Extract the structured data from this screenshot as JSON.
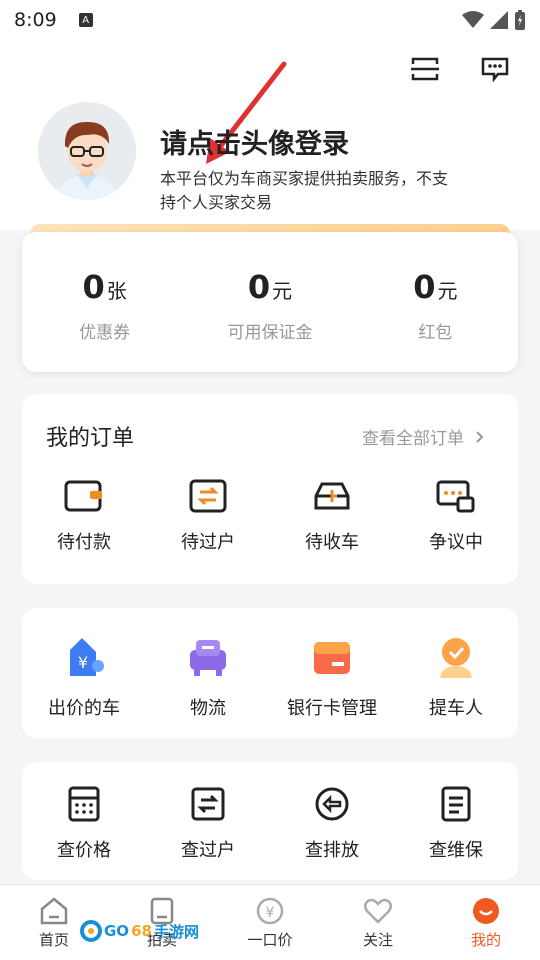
{
  "status": {
    "time": "8:09"
  },
  "profile": {
    "title": "请点击头像登录",
    "subtitle": "本平台仅为车商买家提供拍卖服务，不支持个人买家交易"
  },
  "stats": [
    {
      "num": "0",
      "unit": "张",
      "label": "优惠券"
    },
    {
      "num": "0",
      "unit": "元",
      "label": "可用保证金"
    },
    {
      "num": "0",
      "unit": "元",
      "label": "红包"
    }
  ],
  "orders": {
    "title": "我的订单",
    "view_all": "查看全部订单",
    "items": [
      {
        "label": "待付款",
        "icon": "wallet-icon"
      },
      {
        "label": "待过户",
        "icon": "transfer-icon"
      },
      {
        "label": "待收车",
        "icon": "car-icon"
      },
      {
        "label": "争议中",
        "icon": "dispute-icon"
      }
    ]
  },
  "services": {
    "items": [
      {
        "label": "出价的车",
        "icon": "price-tag-icon"
      },
      {
        "label": "物流",
        "icon": "logistics-icon"
      },
      {
        "label": "银行卡管理",
        "icon": "bank-card-icon"
      },
      {
        "label": "提车人",
        "icon": "pickup-person-icon"
      }
    ]
  },
  "tools": {
    "items": [
      {
        "label": "查价格",
        "icon": "calculator-icon"
      },
      {
        "label": "查过户",
        "icon": "check-transfer-icon"
      },
      {
        "label": "查排放",
        "icon": "emission-icon"
      },
      {
        "label": "查维保",
        "icon": "maintenance-icon"
      }
    ]
  },
  "tabbar": {
    "items": [
      {
        "label": "首页",
        "icon": "home-icon"
      },
      {
        "label": "拍卖",
        "icon": "auction-icon"
      },
      {
        "label": "一口价",
        "icon": "fixed-price-icon"
      },
      {
        "label": "关注",
        "icon": "heart-icon"
      },
      {
        "label": "我的",
        "icon": "profile-icon"
      }
    ],
    "active": "我的"
  },
  "watermark": {
    "part1": "GO",
    "part2": "68",
    "part3": "手游网"
  },
  "colors": {
    "accent": "#f05a22",
    "gold": "#fccf8d",
    "arrow": "#e03030"
  }
}
